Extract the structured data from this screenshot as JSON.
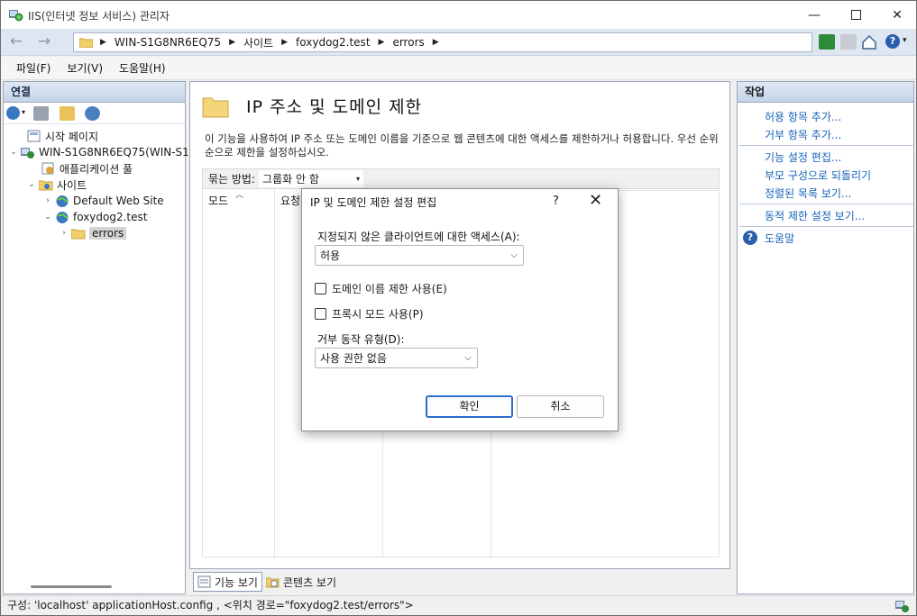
{
  "window": {
    "title": "IIS(인터넷 정보 서비스) 관리자"
  },
  "address": {
    "crumbs": [
      "WIN-S1G8NR6EQ75",
      "사이트",
      "foxydog2.test",
      "errors"
    ]
  },
  "menu": [
    "파일(F)",
    "보기(V)",
    "도움말(H)"
  ],
  "connections": {
    "title": "연결",
    "tree": [
      {
        "label": "시작 페이지",
        "icon": "start-page-icon"
      },
      {
        "label": "WIN-S1G8NR6EQ75(WIN-S1",
        "icon": "server-icon"
      },
      {
        "label": "애플리케이션 풀",
        "icon": "app-pool-icon"
      },
      {
        "label": "사이트",
        "icon": "sites-folder-icon"
      },
      {
        "label": "Default Web Site",
        "icon": "globe-icon"
      },
      {
        "label": "foxydog2.test",
        "icon": "globe-icon"
      },
      {
        "label": "errors",
        "icon": "folder-icon"
      }
    ]
  },
  "feature": {
    "title": "IP 주소 및 도메인 제한",
    "description": "이 기능을 사용하여 IP 주소 또는 도메인 이름을 기준으로 웹 콘텐츠에 대한 액세스를 제한하거나 허용합니다. 우선 순위 순으로 제한을 설정하십시오.",
    "group_by_label": "묶는 방법:",
    "group_by_value": "그룹화 안 함",
    "columns": [
      "모드",
      "요청"
    ]
  },
  "view_tabs": [
    "기능 보기",
    "콘텐츠 보기"
  ],
  "actions": {
    "title": "작업",
    "group1": [
      "허용 항목 추가...",
      "거부 항목 추가..."
    ],
    "group2": [
      "기능 설정 편집...",
      "부모 구성으로 되돌리기",
      "정렬된 목록 보기..."
    ],
    "group3": [
      "동적 제한 설정 보기..."
    ],
    "help": "도움말"
  },
  "status": "구성: 'localhost' applicationHost.config , <위치 경로=\"foxydog2.test/errors\">",
  "dialog": {
    "title": "IP 및 도메인 제한 설정 편집",
    "help_glyph": "?",
    "access_label": "지정되지 않은 클라이언트에 대한 액세스(A):",
    "access_value": "허용",
    "domain_check_label": "도메인 이름 제한 사용(E)",
    "proxy_check_label": "프록시 모드 사용(P)",
    "deny_label": "거부 동작 유형(D):",
    "deny_value": "사용 권한 없음",
    "ok": "확인",
    "cancel": "취소"
  },
  "colors": {
    "link": "#1562b7",
    "pane_header": "#c4d4e8",
    "accent_button": "#2f6dcd"
  }
}
